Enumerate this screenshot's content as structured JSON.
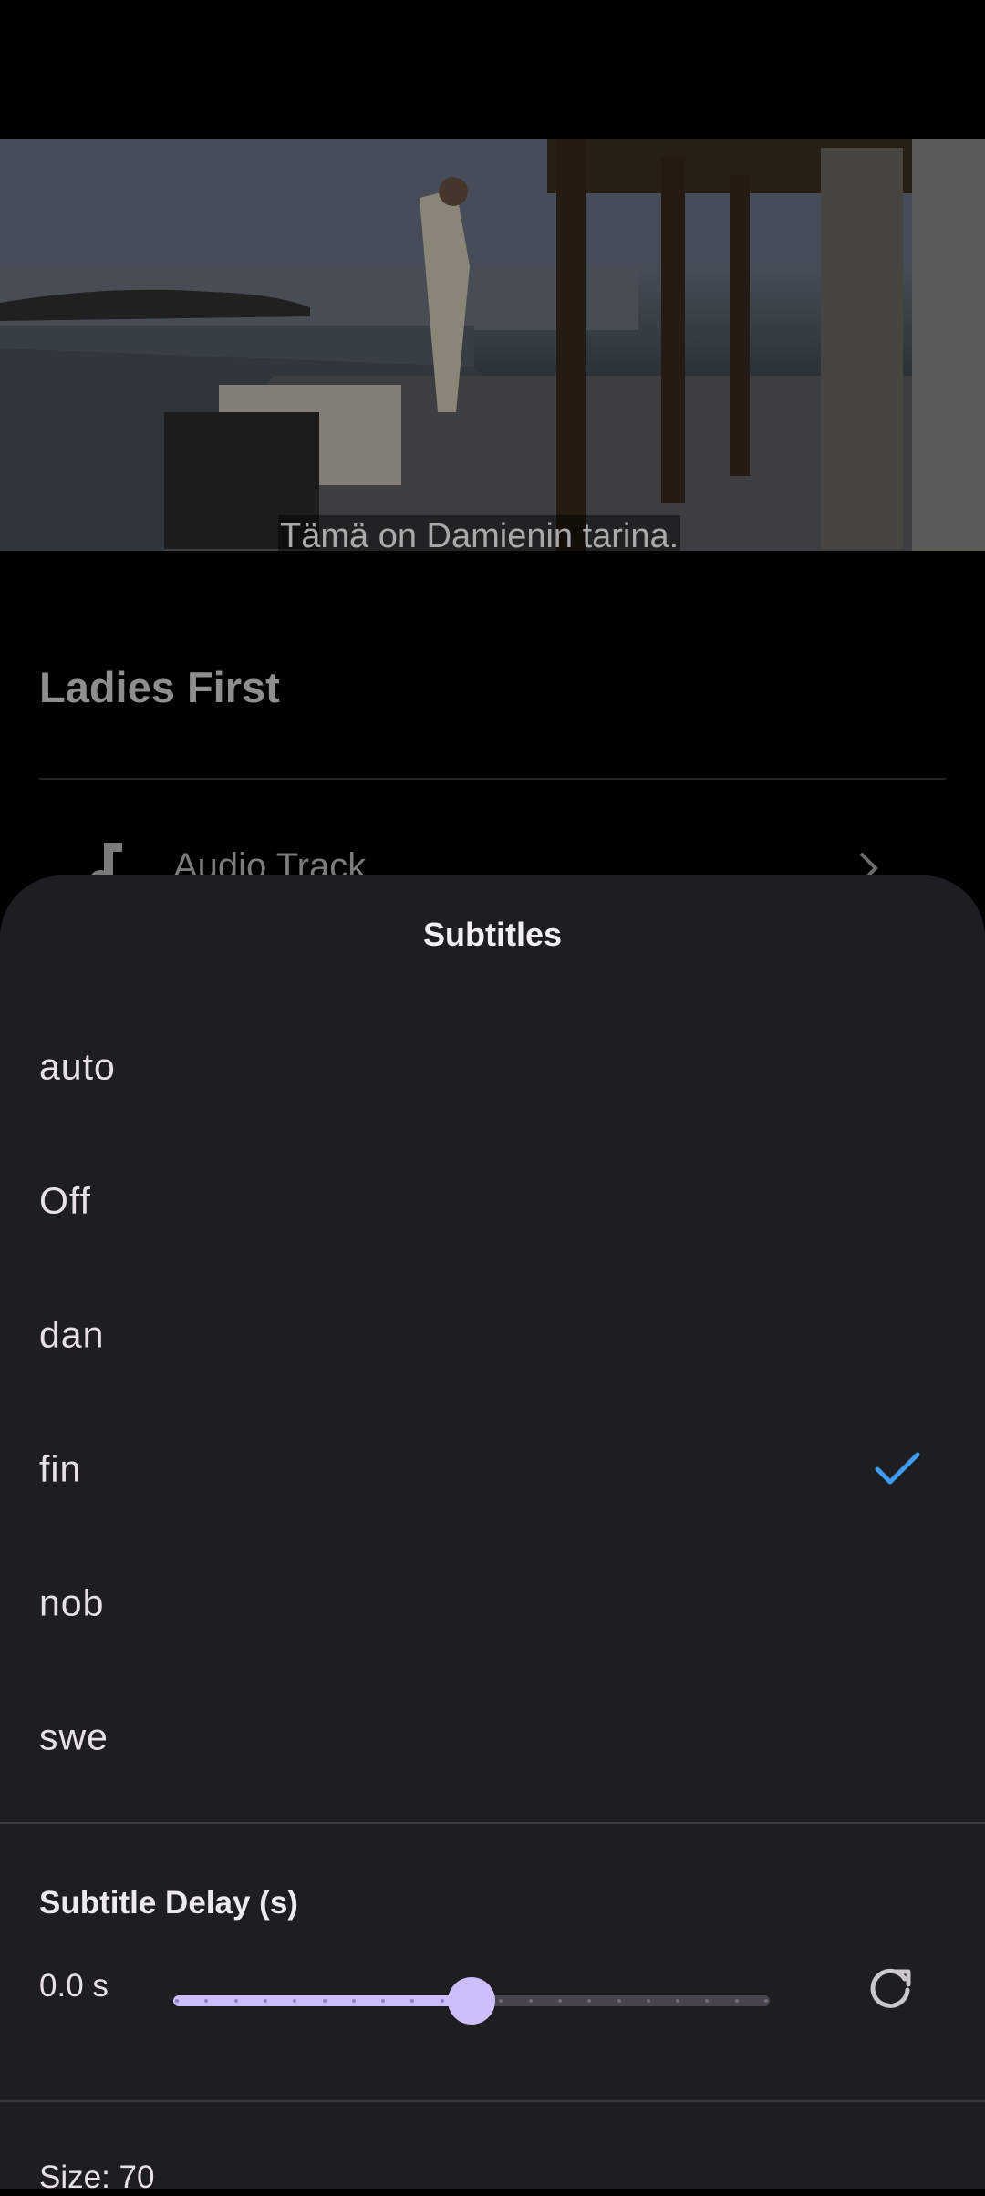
{
  "player": {
    "subtitle_caption": "Tämä on Damienin tarina.",
    "movie_title": "Ladies First",
    "audio_track_label": "Audio Track"
  },
  "sheet": {
    "title": "Subtitles",
    "options": [
      {
        "label": "auto",
        "selected": false
      },
      {
        "label": "Off",
        "selected": false
      },
      {
        "label": "dan",
        "selected": false
      },
      {
        "label": "fin",
        "selected": true
      },
      {
        "label": "nob",
        "selected": false
      },
      {
        "label": "swe",
        "selected": false
      }
    ],
    "delay": {
      "title": "Subtitle Delay (s)",
      "value_text": "0.0 s",
      "slider_fraction": 0.5
    },
    "size_label": "Size: 70"
  },
  "colors": {
    "sheet_bg": "#1e1d22",
    "accent": "#cdbdf9",
    "check": "#3f9bf0"
  },
  "icons": [
    "music-note-icon",
    "chevron-right-icon",
    "checkmark-icon",
    "reset-icon"
  ]
}
